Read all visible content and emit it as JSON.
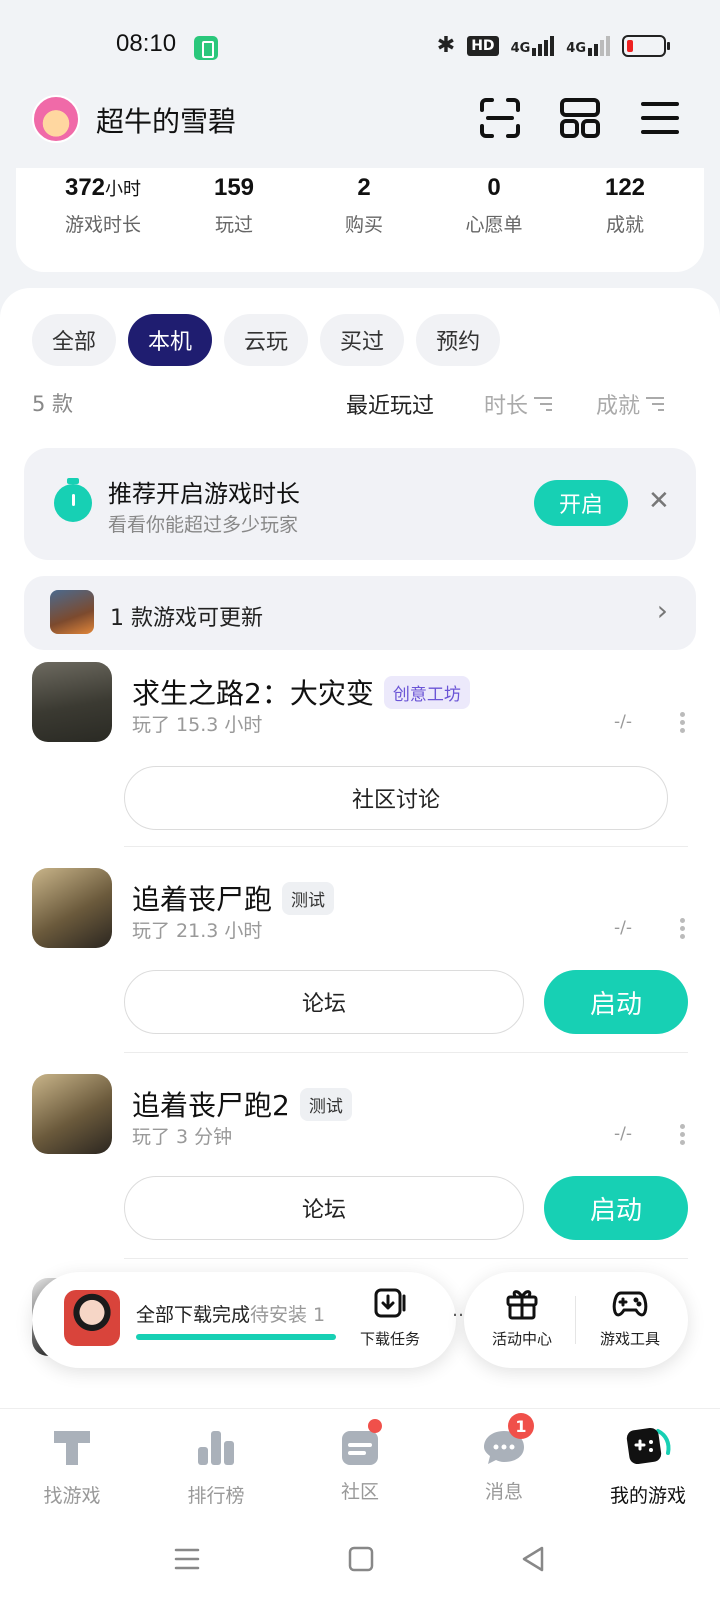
{
  "status_bar": {
    "time": "08:10",
    "hd": "HD",
    "net1": "4G",
    "net2": "4G"
  },
  "header": {
    "user_name": "超牛的雪碧"
  },
  "stats": [
    {
      "value": "372",
      "unit": "小时",
      "label": "游戏时长"
    },
    {
      "value": "159",
      "unit": "",
      "label": "玩过"
    },
    {
      "value": "2",
      "unit": "",
      "label": "购买"
    },
    {
      "value": "0",
      "unit": "",
      "label": "心愿单"
    },
    {
      "value": "122",
      "unit": "",
      "label": "成就"
    }
  ],
  "tabs": [
    {
      "label": "全部",
      "active": false
    },
    {
      "label": "本机",
      "active": true
    },
    {
      "label": "云玩",
      "active": false
    },
    {
      "label": "买过",
      "active": false
    },
    {
      "label": "预约",
      "active": false
    }
  ],
  "sort": {
    "count": "5 款",
    "recent": "最近玩过",
    "duration": "时长",
    "achievements": "成就"
  },
  "promo": {
    "title": "推荐开启游戏时长",
    "subtitle": "看看你能超过多少玩家",
    "button": "开启",
    "close": "✕"
  },
  "update_bar": {
    "text": "1 款游戏可更新",
    "chevron": "›"
  },
  "games": [
    {
      "title": "求生之路2：大灾变",
      "badge": "创意工坊",
      "played": "玩了 15.3 小时",
      "rating": "-/-",
      "primary": "社区讨论",
      "launch": ""
    },
    {
      "title": "追着丧尸跑",
      "badge": "测试",
      "played": "玩了 21.3 小时",
      "rating": "-/-",
      "primary": "论坛",
      "launch": "启动"
    },
    {
      "title": "追着丧尸跑2",
      "badge": "测试",
      "played": "玩了 3 分钟",
      "rating": "-/-",
      "primary": "论坛",
      "launch": "启动"
    }
  ],
  "download_bar": {
    "status": "全部下载完成",
    "pending": "待安装 1",
    "progress": 1.0,
    "task_label": "下载任务"
  },
  "tools": {
    "more": "…",
    "activity": "活动中心",
    "game_tools": "游戏工具"
  },
  "bottom_nav": [
    {
      "label": "找游戏",
      "icon": "find-game-icon",
      "active": false
    },
    {
      "label": "排行榜",
      "icon": "ranking-icon",
      "active": false
    },
    {
      "label": "社区",
      "icon": "community-icon",
      "active": false
    },
    {
      "label": "消息",
      "icon": "message-icon",
      "active": false,
      "badge": "1"
    },
    {
      "label": "我的游戏",
      "icon": "my-games-icon",
      "active": true
    }
  ],
  "colors": {
    "accent": "#17d0b4",
    "tab_active": "#1f1d70",
    "badge_red": "#f0504a",
    "purple": "#6b55d6"
  }
}
